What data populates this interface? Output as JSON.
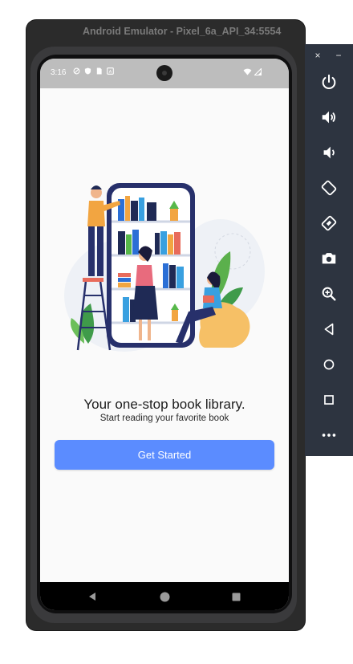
{
  "window": {
    "title": "Android Emulator - Pixel_6a_API_34:5554"
  },
  "status_bar": {
    "time": "3:16"
  },
  "onboarding": {
    "headline": "Your one-stop book library.",
    "subline": "Start reading your favorite book",
    "cta_label": "Get Started"
  },
  "toolbar": {
    "close_label": "×",
    "minimize_label": "−",
    "items": [
      "power-icon",
      "volume-up-icon",
      "volume-down-icon",
      "rotate-left-icon",
      "rotate-right-icon",
      "camera-icon",
      "zoom-icon",
      "back-icon",
      "home-icon",
      "overview-icon",
      "more-icon"
    ]
  },
  "colors": {
    "accent": "#5b8cff",
    "toolbar_bg": "#2d3440",
    "status_bar_bg": "#bdbdbd"
  }
}
